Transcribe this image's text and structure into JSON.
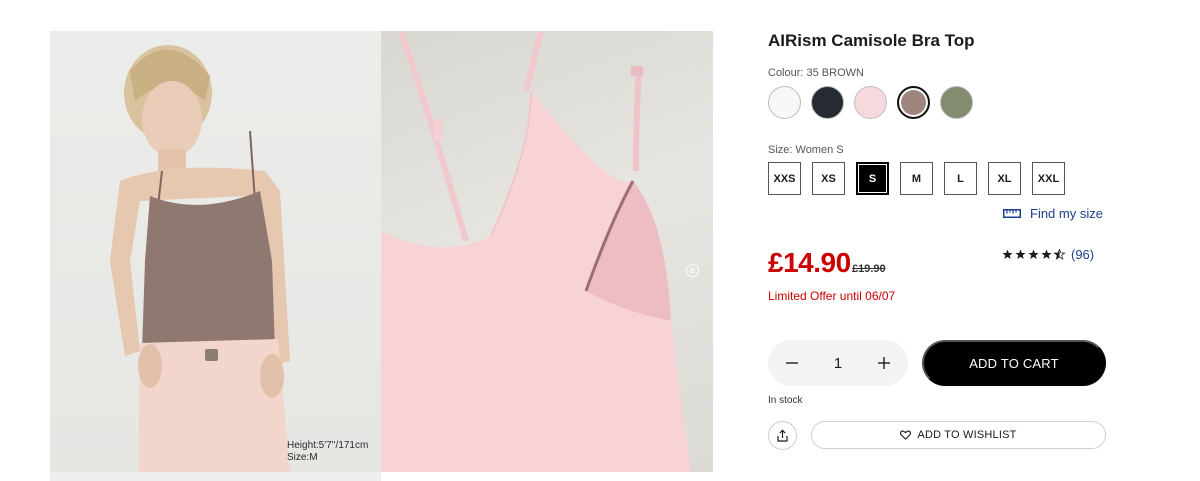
{
  "product": {
    "title": "AIRism Camisole Bra Top",
    "color_label": "Colour: 35 BROWN",
    "colors": [
      {
        "name": "white",
        "hex": "#f7f7f7"
      },
      {
        "name": "black",
        "hex": "#262a33"
      },
      {
        "name": "pink",
        "hex": "#f6d9dc"
      },
      {
        "name": "brown",
        "hex": "#9e857d",
        "selected": true
      },
      {
        "name": "olive",
        "hex": "#838c70"
      }
    ],
    "size_label": "Size: Women S",
    "sizes": [
      {
        "label": "XXS"
      },
      {
        "label": "XS"
      },
      {
        "label": "S",
        "selected": true
      },
      {
        "label": "M"
      },
      {
        "label": "L"
      },
      {
        "label": "XL"
      },
      {
        "label": "XXL"
      }
    ],
    "find_size": "Find my size",
    "price": "£14.90",
    "old_price": "£19.90",
    "rating": {
      "stars": 4.5,
      "count_text": "(96)"
    },
    "offer": "Limited Offer until 06/07",
    "quantity": "1",
    "add_to_cart": "ADD TO CART",
    "stock": "In stock",
    "wishlist": "ADD TO WISHLIST"
  },
  "gallery": {
    "model_caption_height": "Height:5'7''/171cm",
    "model_caption_size": "Size:M"
  },
  "colors": {
    "sale_red": "#cc0000",
    "link_blue": "#1b3f8e",
    "button_black": "#000000"
  },
  "icons": [
    "minus-icon",
    "plus-icon",
    "ruler-icon",
    "star-icon",
    "share-icon",
    "heart-icon",
    "zoom-icon"
  ]
}
